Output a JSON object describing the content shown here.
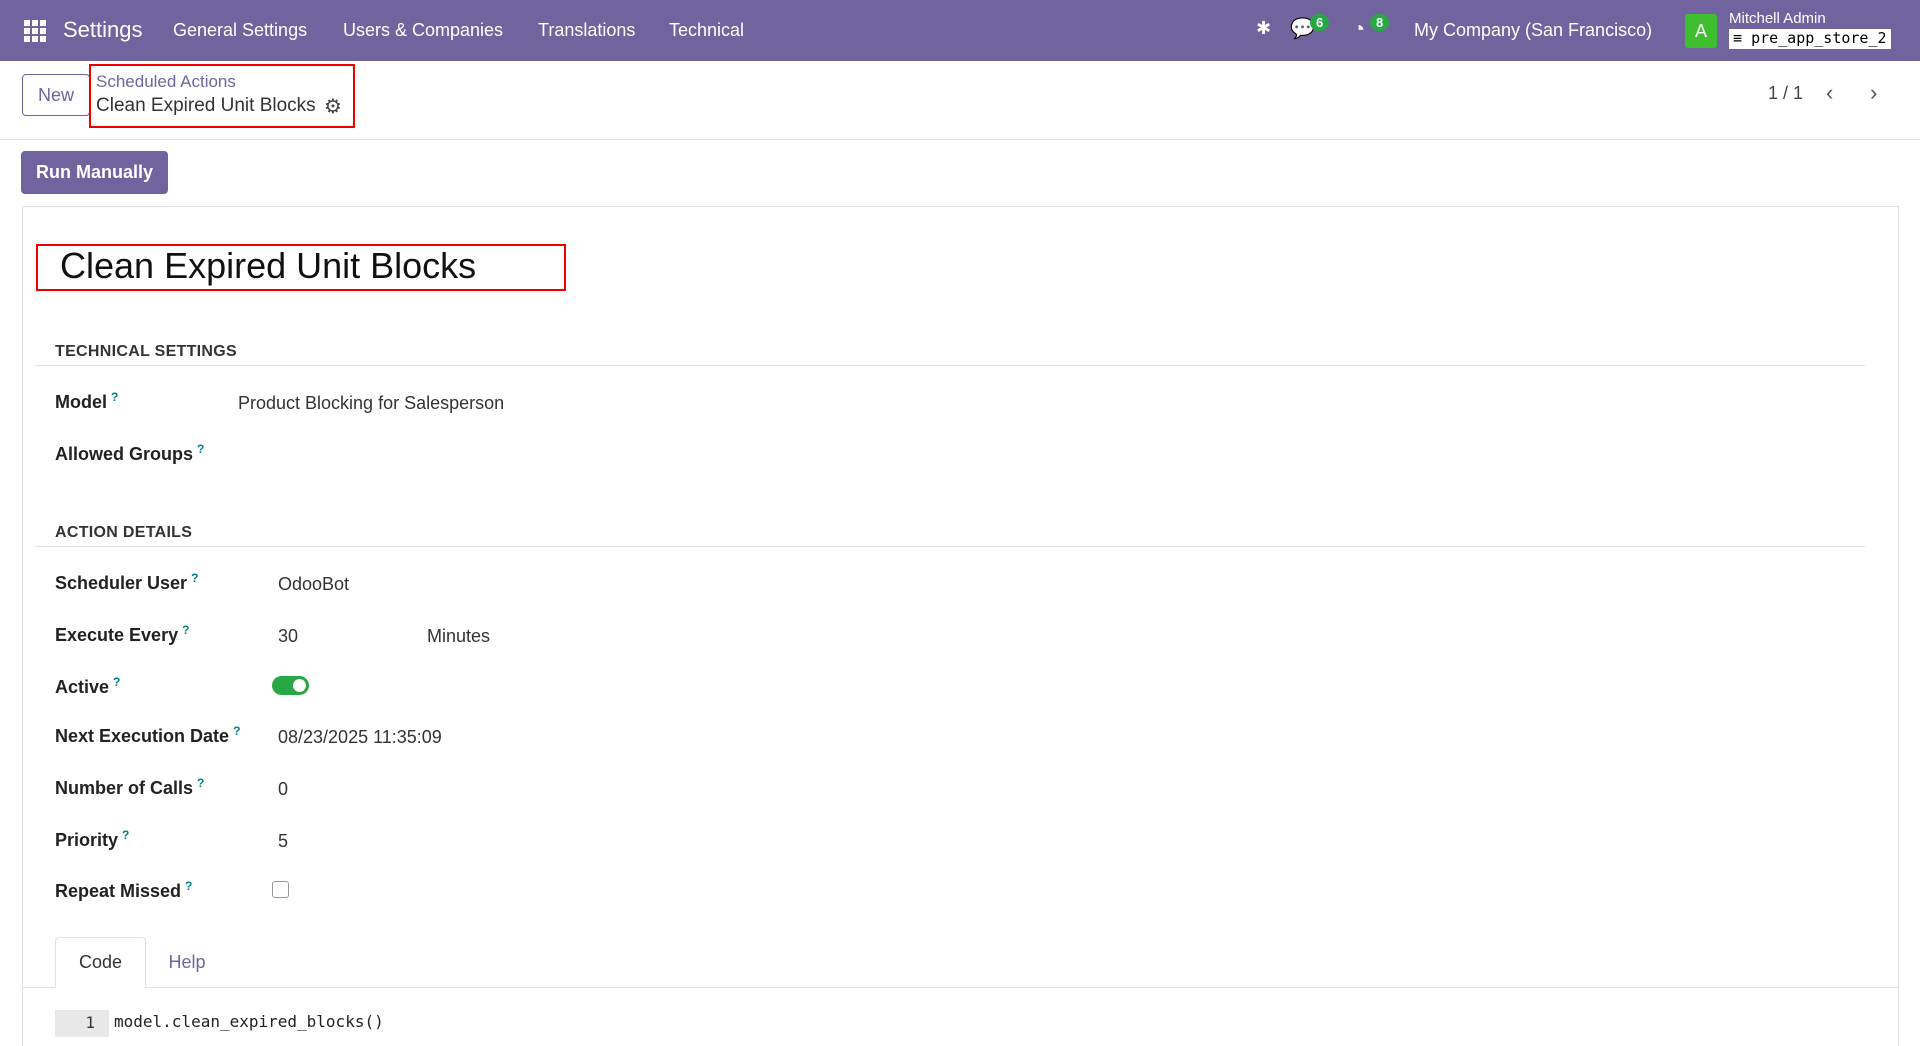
{
  "nav": {
    "app": "Settings",
    "menus": [
      "General Settings",
      "Users & Companies",
      "Translations",
      "Technical"
    ],
    "messages_count": "6",
    "activities_count": "8",
    "company": "My Company (San Francisco)",
    "avatar_letter": "A",
    "user": "Mitchell Admin",
    "database": "pre_app_store_2"
  },
  "control": {
    "new_label": "New",
    "breadcrumb_parent": "Scheduled Actions",
    "breadcrumb_current": "Clean Expired Unit Blocks",
    "pager": "1 / 1",
    "run_label": "Run Manually"
  },
  "form": {
    "title": "Clean Expired Unit Blocks",
    "technical_header": "TECHNICAL SETTINGS",
    "model_label": "Model",
    "model_value": "Product Blocking for Salesperson",
    "groups_label": "Allowed Groups",
    "action_header": "ACTION DETAILS",
    "user_label": "Scheduler User",
    "user_value": "OdooBot",
    "every_label": "Execute Every",
    "every_value": "30",
    "every_unit": "Minutes",
    "active_label": "Active",
    "active_value": true,
    "next_label": "Next Execution Date",
    "next_value": "08/23/2025 11:35:09",
    "calls_label": "Number of Calls",
    "calls_value": "0",
    "priority_label": "Priority",
    "priority_value": "5",
    "missed_label": "Repeat Missed",
    "missed_value": false,
    "help_mark": "?"
  },
  "tabs": {
    "code": "Code",
    "help": "Help"
  },
  "code": {
    "line_no": "1",
    "line": "model.clean_expired_blocks()"
  }
}
